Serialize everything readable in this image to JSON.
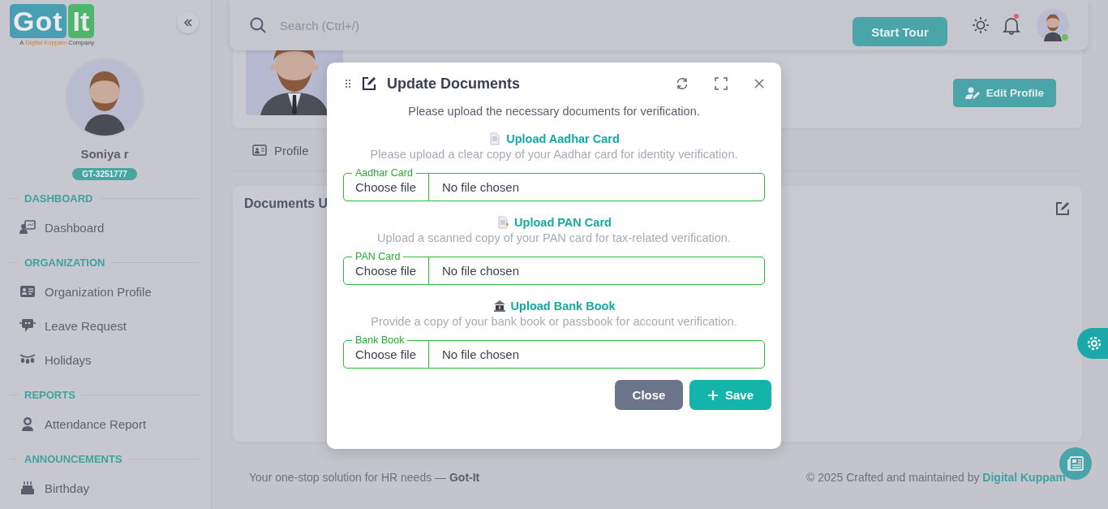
{
  "logo": {
    "word_1": "Got",
    "word_2": "It",
    "tagline_prefix": "A",
    "tagline_brand": "Digital Kuppam",
    "tagline_suffix": "Company"
  },
  "sidebar": {
    "user_name": "Soniya r",
    "employee_id": "GT-3251777",
    "sections": [
      {
        "title": "DASHBOARD",
        "items": [
          {
            "label": "Dashboard"
          }
        ]
      },
      {
        "title": "ORGANIZATION",
        "items": [
          {
            "label": "Organization Profile"
          },
          {
            "label": "Leave Request"
          },
          {
            "label": "Holidays"
          }
        ]
      },
      {
        "title": "REPORTS",
        "items": [
          {
            "label": "Attendance Report"
          }
        ]
      },
      {
        "title": "ANNOUNCEMENTS",
        "items": [
          {
            "label": "Birthday"
          }
        ]
      }
    ]
  },
  "header": {
    "search": {
      "placeholder": "Search (Ctrl+/)"
    },
    "start_tour": "Start Tour",
    "notification_dot": true,
    "online": true
  },
  "profile": {
    "edit_button": "Edit Profile",
    "tabs": [
      {
        "label": "Profile"
      }
    ],
    "documents_title": "Documents U"
  },
  "dialog": {
    "title": "Update Documents",
    "intro": "Please upload the necessary documents for verification.",
    "uploads": [
      {
        "heading": "Upload Aadhar Card",
        "description": "Please upload a clear copy of your Aadhar card for identity verification.",
        "field_label": "Aadhar Card",
        "button": "Choose file",
        "status": "No file chosen"
      },
      {
        "heading": "Upload PAN Card",
        "description": "Upload a scanned copy of your PAN card for tax-related verification.",
        "field_label": "PAN Card",
        "button": "Choose file",
        "status": "No file chosen"
      },
      {
        "heading": "Upload Bank Book",
        "description": "Provide a copy of your bank book or passbook for account verification.",
        "field_label": "Bank Book",
        "button": "Choose file",
        "status": "No file chosen"
      }
    ],
    "close_button": "Close",
    "save_button": "Save"
  },
  "footer": {
    "tagline": "Your one-stop solution for HR needs — **Got-It**",
    "credit": "© 2025 Crafted and maintained by",
    "credit_link": "Digital Kuppam"
  }
}
